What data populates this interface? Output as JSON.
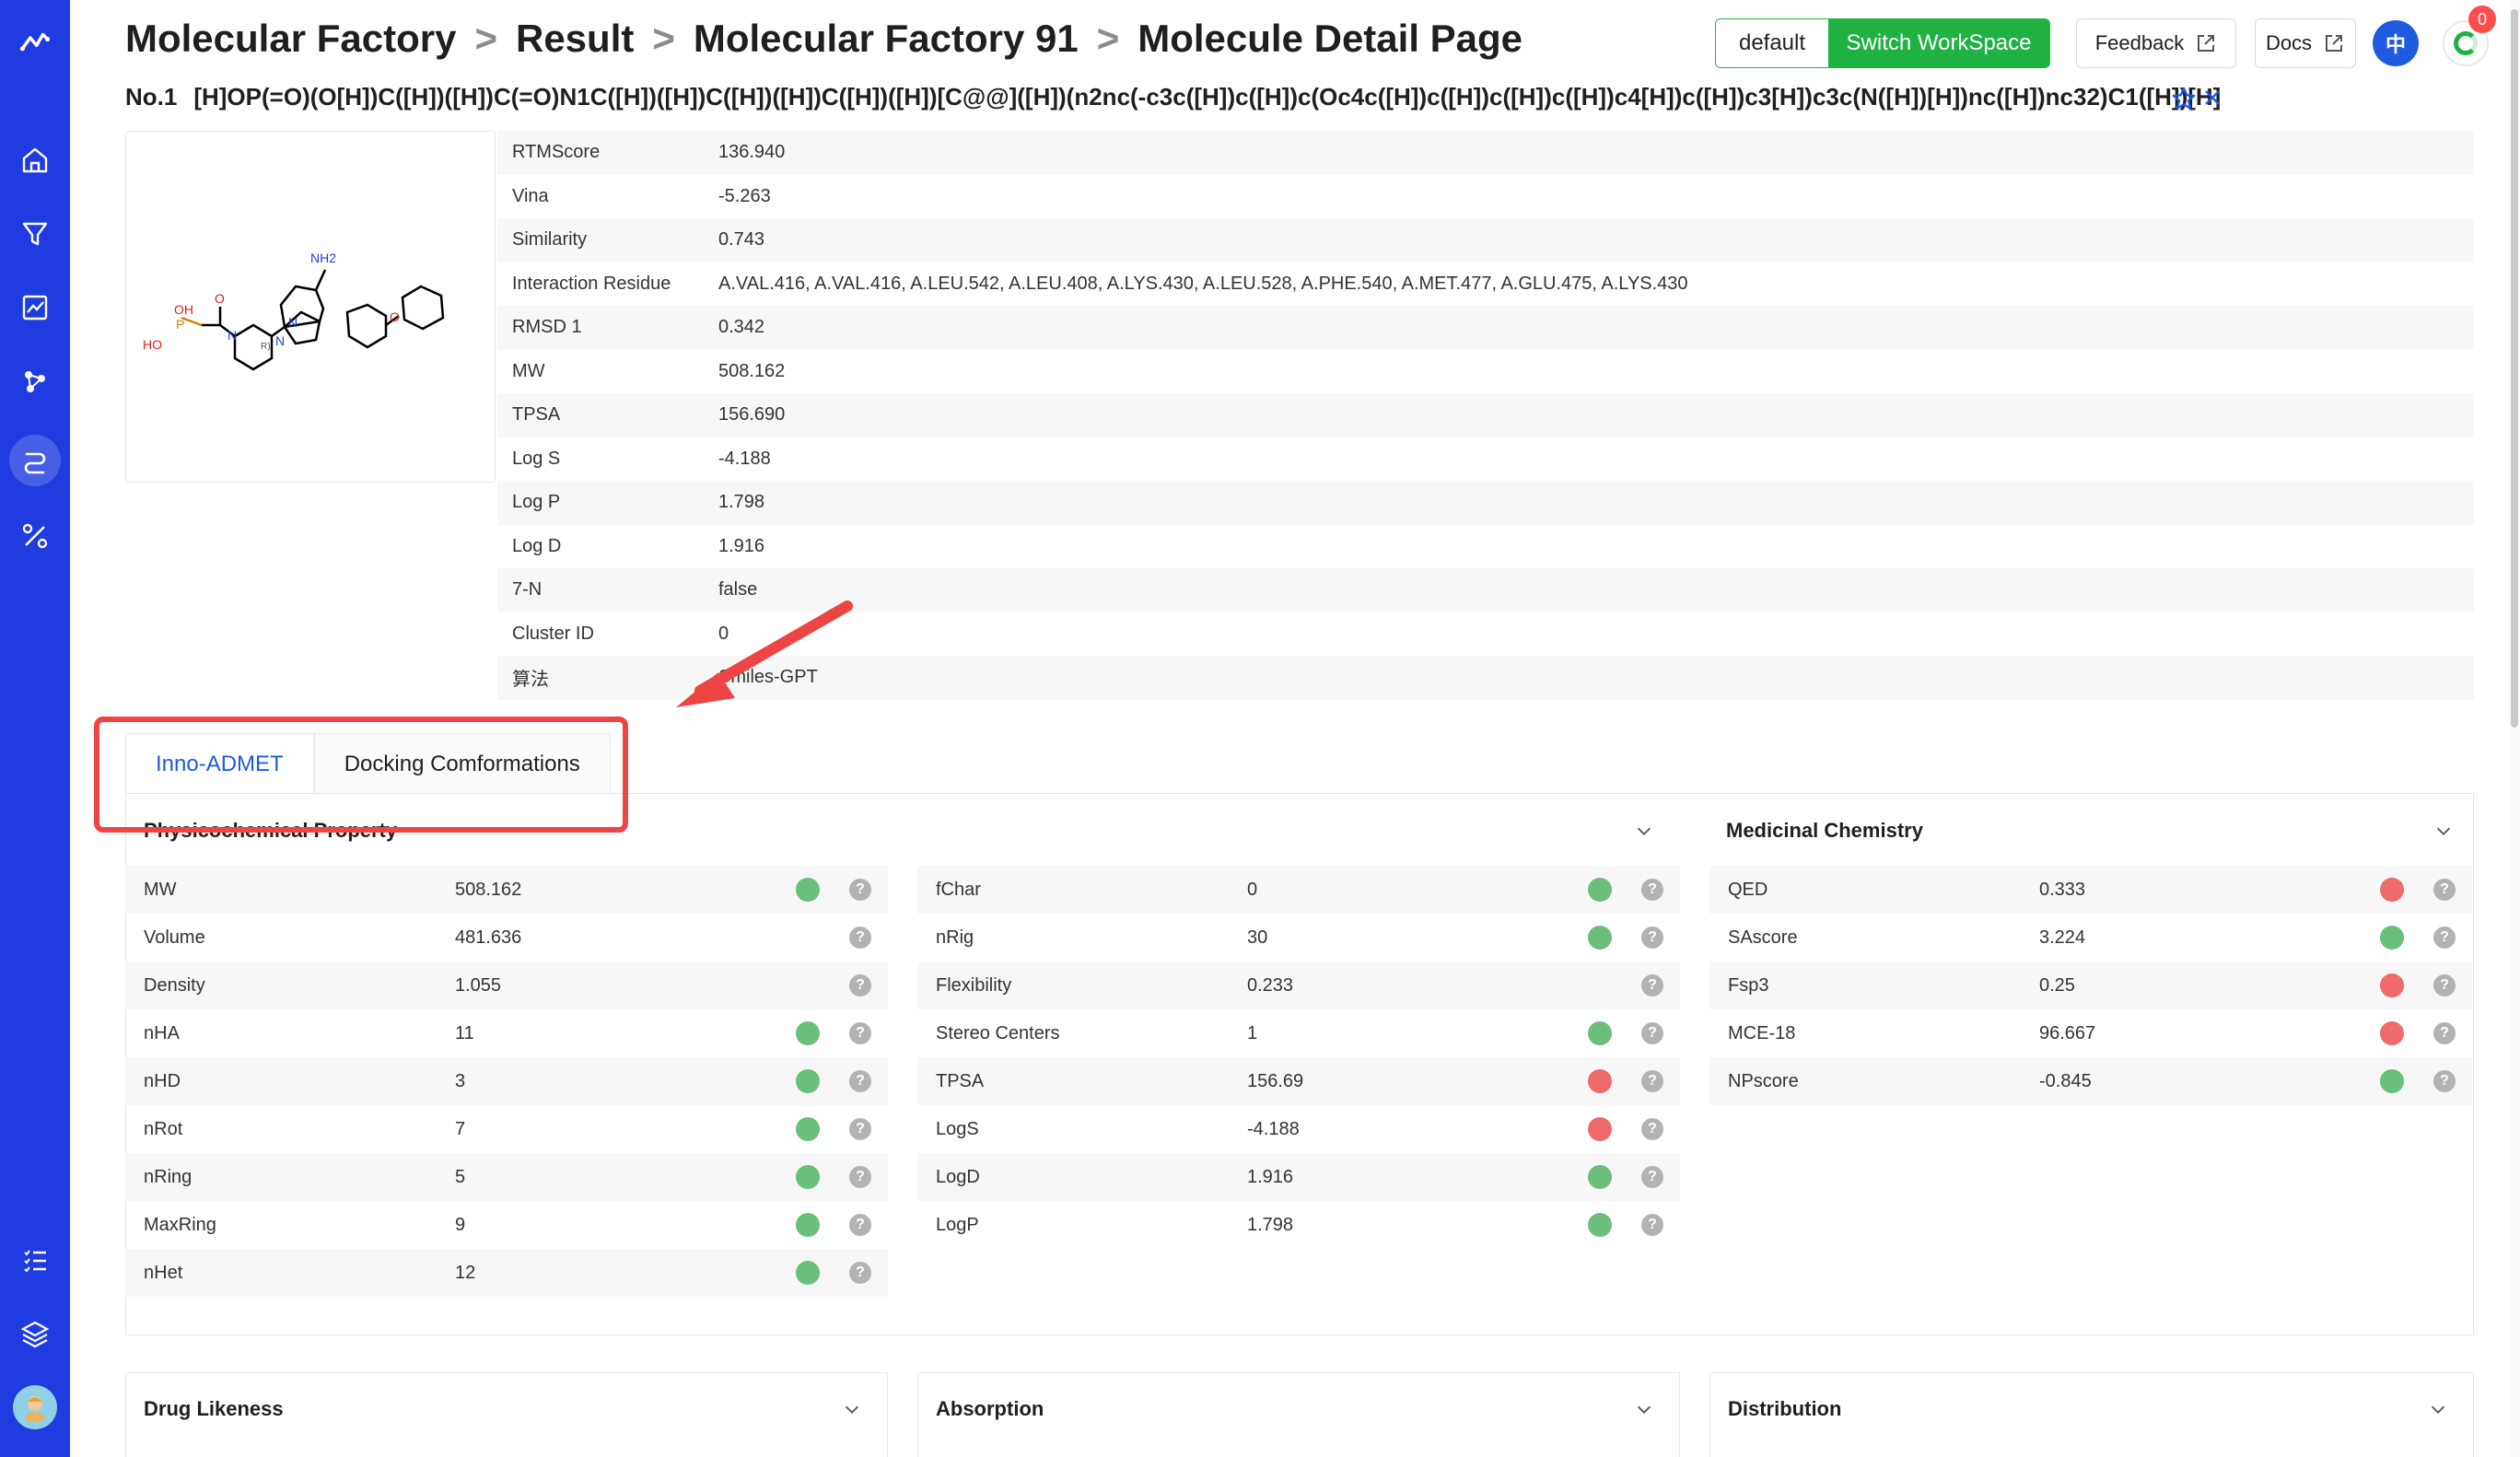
{
  "breadcrumb": [
    "Molecular Factory",
    "Result",
    "Molecular Factory 91",
    "Molecule Detail Page"
  ],
  "breadcrumb_sep": ">",
  "header": {
    "workspace_default": "default",
    "switch_workspace": "Switch WorkSpace",
    "feedback": "Feedback",
    "docs": "Docs",
    "lang": "中",
    "notification_count": "0",
    "accent_color": "#1f3ce0",
    "green_color": "#1fb243"
  },
  "molecule": {
    "number": "No.1",
    "smiles": "[H]OP(=O)(O[H])C([H])([H])C(=O)N1C([H])([H])C([H])([H])C([H])([H])[C@@]([H])(n2nc(-c3c([H])c([H])c(Oc4c([H])c([H])c([H])c([H])c4[H])c([H])c3[H])c3c(N([H])[H])nc([H])nc32)C1([H])[H]"
  },
  "structure_labels": {
    "nh2": "NH2",
    "oh": "OH",
    "ho": "HO",
    "p": "P",
    "o": "O",
    "n": "N",
    "stereo": "R)"
  },
  "properties": [
    {
      "label": "RTMScore",
      "value": "136.940"
    },
    {
      "label": "Vina",
      "value": "-5.263"
    },
    {
      "label": "Similarity",
      "value": "0.743"
    },
    {
      "label": "Interaction Residue",
      "value": "A.VAL.416, A.VAL.416, A.LEU.542, A.LEU.408, A.LYS.430, A.LEU.528, A.PHE.540, A.MET.477, A.GLU.475, A.LYS.430"
    },
    {
      "label": "RMSD 1",
      "value": "0.342"
    },
    {
      "label": "MW",
      "value": "508.162"
    },
    {
      "label": "TPSA",
      "value": "156.690"
    },
    {
      "label": "Log S",
      "value": "-4.188"
    },
    {
      "label": "Log P",
      "value": "1.798"
    },
    {
      "label": "Log D",
      "value": "1.916"
    },
    {
      "label": "7-N",
      "value": "false"
    },
    {
      "label": "Cluster ID",
      "value": "0"
    },
    {
      "label": "算法",
      "value": "Smiles-GPT"
    }
  ],
  "tabs": [
    {
      "label": "Inno-ADMET",
      "active": true
    },
    {
      "label": "Docking Comformations",
      "active": false
    }
  ],
  "sections": {
    "physchem": {
      "title": "Physicochemical Property",
      "rows": [
        {
          "label": "MW",
          "value": "508.162",
          "status": "green"
        },
        {
          "label": "Volume",
          "value": "481.636",
          "status": "none"
        },
        {
          "label": "Density",
          "value": "1.055",
          "status": "none"
        },
        {
          "label": "nHA",
          "value": "11",
          "status": "green"
        },
        {
          "label": "nHD",
          "value": "3",
          "status": "green"
        },
        {
          "label": "nRot",
          "value": "7",
          "status": "green"
        },
        {
          "label": "nRing",
          "value": "5",
          "status": "green"
        },
        {
          "label": "MaxRing",
          "value": "9",
          "status": "green"
        },
        {
          "label": "nHet",
          "value": "12",
          "status": "green"
        }
      ]
    },
    "physchem2": {
      "rows": [
        {
          "label": "fChar",
          "value": "0",
          "status": "green"
        },
        {
          "label": "nRig",
          "value": "30",
          "status": "green"
        },
        {
          "label": "Flexibility",
          "value": "0.233",
          "status": "none"
        },
        {
          "label": "Stereo Centers",
          "value": "1",
          "status": "green"
        },
        {
          "label": "TPSA",
          "value": "156.69",
          "status": "red"
        },
        {
          "label": "LogS",
          "value": "-4.188",
          "status": "red"
        },
        {
          "label": "LogD",
          "value": "1.916",
          "status": "green"
        },
        {
          "label": "LogP",
          "value": "1.798",
          "status": "green"
        }
      ]
    },
    "medchem": {
      "title": "Medicinal Chemistry",
      "rows": [
        {
          "label": "QED",
          "value": "0.333",
          "status": "red"
        },
        {
          "label": "SAscore",
          "value": "3.224",
          "status": "green"
        },
        {
          "label": "Fsp3",
          "value": "0.25",
          "status": "red"
        },
        {
          "label": "MCE-18",
          "value": "96.667",
          "status": "red"
        },
        {
          "label": "NPscore",
          "value": "-0.845",
          "status": "green"
        }
      ]
    }
  },
  "help_glyph": "?",
  "bottom_sections": [
    "Drug Likeness",
    "Absorption",
    "Distribution"
  ]
}
